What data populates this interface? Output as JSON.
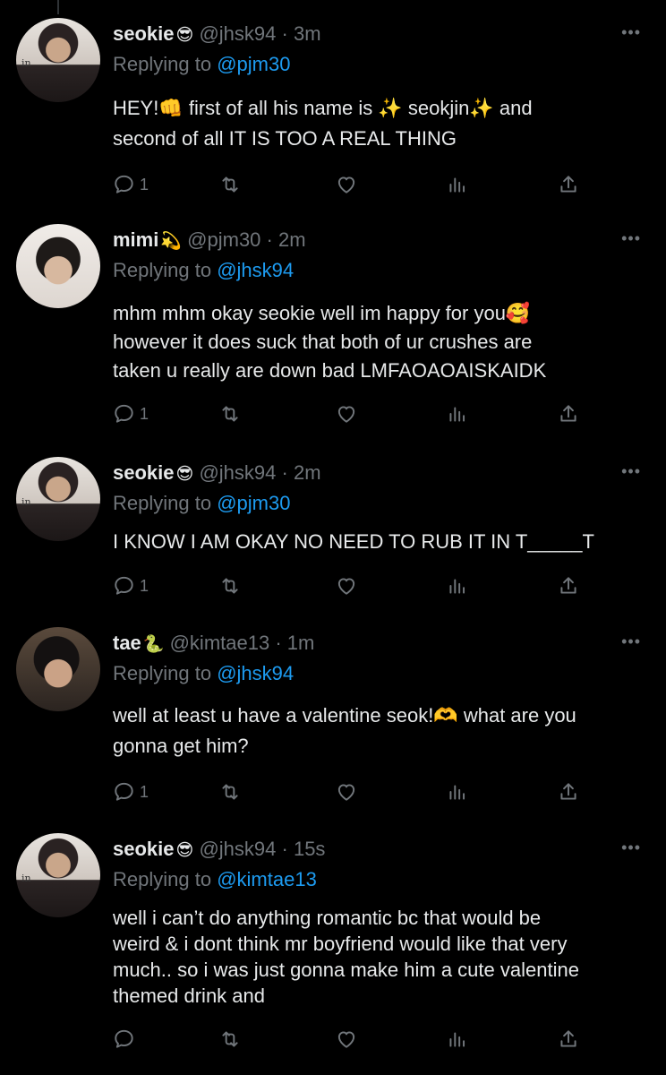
{
  "tweets": [
    {
      "name": "seokie",
      "emoji": "😎",
      "handle": "@jhsk94",
      "time": "3m",
      "replying_label": "Replying to",
      "replying_to": "@pjm30",
      "body_lines": [
        "HEY!👊 first of all his name is ✨ seokjin✨ and",
        "second of all IT IS TOO A REAL THING"
      ],
      "reply_count": "1",
      "avatar": "seokie"
    },
    {
      "name": "mimi",
      "emoji": "💫",
      "handle": "@pjm30",
      "time": "2m",
      "replying_label": "Replying to",
      "replying_to": "@jhsk94",
      "body_lines": [
        "mhm mhm okay seokie well im happy for you🥰",
        "however it does suck that both of ur crushes are",
        "taken u really are down bad LMFAOAOAISKAIDK"
      ],
      "reply_count": "1",
      "avatar": "mimi"
    },
    {
      "name": "seokie",
      "emoji": "😎",
      "handle": "@jhsk94",
      "time": "2m",
      "replying_label": "Replying to",
      "replying_to": "@pjm30",
      "body_lines": [
        "I KNOW I AM OKAY NO NEED TO RUB IT IN T_____T"
      ],
      "reply_count": "1",
      "avatar": "seokie"
    },
    {
      "name": "tae",
      "emoji": "🐍",
      "handle": "@kimtae13",
      "time": "1m",
      "replying_label": "Replying to",
      "replying_to": "@jhsk94",
      "body_lines": [
        "well at least u have a valentine seok!🫶 what are you",
        "gonna get him?"
      ],
      "reply_count": "1",
      "avatar": "tae"
    },
    {
      "name": "seokie",
      "emoji": "😎",
      "handle": "@jhsk94",
      "time": "15s",
      "replying_label": "Replying to",
      "replying_to": "@kimtae13",
      "body_lines": [
        "well i can’t do anything romantic bc that would be",
        "weird & i dont think mr boyfriend would like that very",
        "much.. so i was just gonna make him a cute valentine",
        "themed drink and"
      ],
      "reply_count": "",
      "avatar": "seokie"
    }
  ],
  "dot_separator": "·",
  "more_icon": "•••",
  "avatar_tag": "in",
  "colors": {
    "background": "#000000",
    "text": "#e7e9ea",
    "muted": "#71767b",
    "link": "#1d9bf0"
  },
  "icons": [
    "reply-icon",
    "retweet-icon",
    "like-icon",
    "views-icon",
    "share-icon"
  ]
}
